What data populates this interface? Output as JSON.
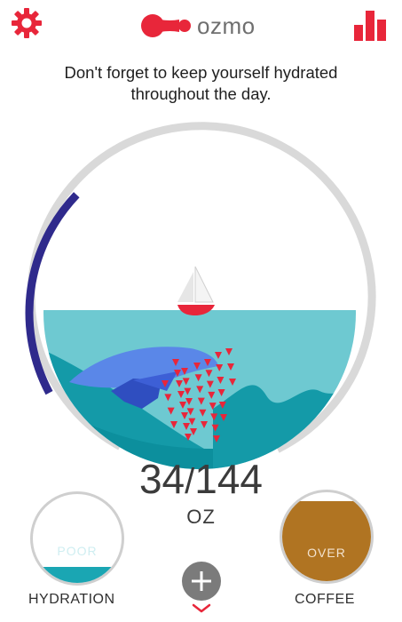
{
  "header": {
    "logo_text": "ozmo",
    "icons": [
      "gear-icon",
      "bar-chart-icon",
      "ozmo-logo-icon"
    ]
  },
  "message": {
    "line1": "Don't forget to keep yourself hydrated",
    "line2": "throughout the day."
  },
  "intake": {
    "current": "34",
    "separator": "/",
    "goal": "144",
    "unit": "OZ",
    "progress_fraction": 0.236
  },
  "hydration": {
    "status": "POOR",
    "label": "HYDRATION",
    "fill_fraction": 0.18
  },
  "coffee": {
    "status": "OVER",
    "label": "COFFEE",
    "fill_fraction": 0.9
  },
  "actions": {
    "add_icon": "plus-icon",
    "expand_icon": "chevron-down-icon"
  },
  "colors": {
    "brand": "#e8263a",
    "progress": "#2f2a8c",
    "track": "#d9d9d9",
    "water": "#1aa6b3",
    "water_light": "#6ec9d1",
    "coffee": "#b07422",
    "button": "#7b7b7b"
  }
}
